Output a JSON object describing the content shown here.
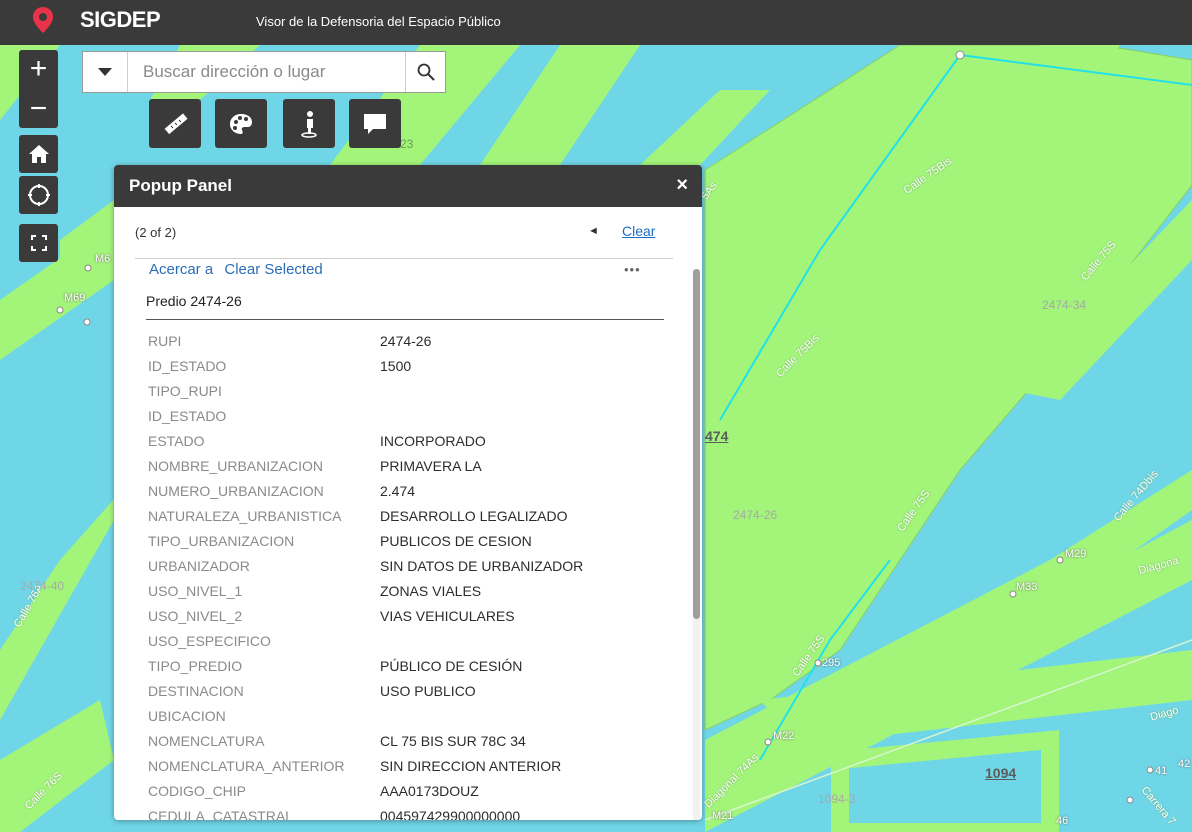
{
  "header": {
    "title": "SIGDEP",
    "subtitle": "Visor de la Defensoria del Espacio Público",
    "logo_icon": "map-pin-icon",
    "logo_color": "#e8334a"
  },
  "search": {
    "placeholder": "Buscar dirección o lugar",
    "value": ""
  },
  "map_controls": {
    "zoom_in": "+",
    "zoom_out": "−"
  },
  "toolbar": [
    "ruler-icon",
    "palette-icon",
    "streetview-icon",
    "comment-icon"
  ],
  "popup": {
    "title": "Popup Panel",
    "close": "×",
    "counter": "(2 of 2)",
    "prev": "◄",
    "clear": "Clear",
    "zoom_to": "Acercar a",
    "clear_selected": "Clear Selected",
    "more": "•••",
    "feature_title": "Predio 2474-26",
    "attributes": [
      {
        "key": "RUPI",
        "value": "2474-26"
      },
      {
        "key": "ID_ESTADO",
        "value": "1500"
      },
      {
        "key": "TIPO_RUPI",
        "value": ""
      },
      {
        "key": "ID_ESTADO",
        "value": ""
      },
      {
        "key": "ESTADO",
        "value": "INCORPORADO"
      },
      {
        "key": "NOMBRE_URBANIZACION",
        "value": "PRIMAVERA LA"
      },
      {
        "key": "NUMERO_URBANIZACION",
        "value": "2.474"
      },
      {
        "key": "NATURALEZA_URBANISTICA",
        "value": "DESARROLLO LEGALIZADO"
      },
      {
        "key": "TIPO_URBANIZACION",
        "value": "PUBLICOS DE CESION"
      },
      {
        "key": "URBANIZADOR",
        "value": "SIN DATOS DE URBANIZADOR"
      },
      {
        "key": "USO_NIVEL_1",
        "value": "ZONAS VIALES"
      },
      {
        "key": "USO_NIVEL_2",
        "value": "VIAS VEHICULARES"
      },
      {
        "key": "USO_ESPECIFICO",
        "value": ""
      },
      {
        "key": "TIPO_PREDIO",
        "value": "PÚBLICO DE CESIÓN"
      },
      {
        "key": "DESTINACION",
        "value": "USO PUBLICO"
      },
      {
        "key": "UBICACION",
        "value": ""
      },
      {
        "key": "NOMENCLATURA",
        "value": "CL 75 BIS SUR 78C 34"
      },
      {
        "key": "NOMENCLATURA_ANTERIOR",
        "value": "SIN DIRECCION ANTERIOR"
      },
      {
        "key": "CODIGO_CHIP",
        "value": "AAA0173DOUZ"
      },
      {
        "key": "CEDULA_CATASTRAL",
        "value": "004597429900000000"
      }
    ]
  },
  "map_labels": {
    "calle_75bis_a": "Calle 75Bis",
    "calle_75bis_b": "Calle 75Bis",
    "calle_75s_a": "Calle 75S",
    "calle_75s_b": "Calle 75S",
    "calle_75s_c": "Calle 75S",
    "calle_74dbis": "Calle 74Dbis",
    "calle_76s": "Calle 76S",
    "calle_76a": "Calle 76A",
    "diagonal_a": "Diagona",
    "diagonal_b": "Diago",
    "diagonal_74as": "Diagonal 74As",
    "carrera": "Carrera 7",
    "calle_5as": "5As",
    "predio_2474_34": "2474-34",
    "predio_2474_26": "2474-26",
    "predio_2474_40": "2474-40",
    "predio_1094_3": "1094-3",
    "urb_474": "474",
    "urb_1094": "1094",
    "m29": "M29",
    "m33": "M33",
    "m22": "M22",
    "m21": "M21",
    "m69": "M69",
    "m6": "M6",
    "n295": "295",
    "n46": "46",
    "n41": "41",
    "n42": "42",
    "n23": "23"
  }
}
